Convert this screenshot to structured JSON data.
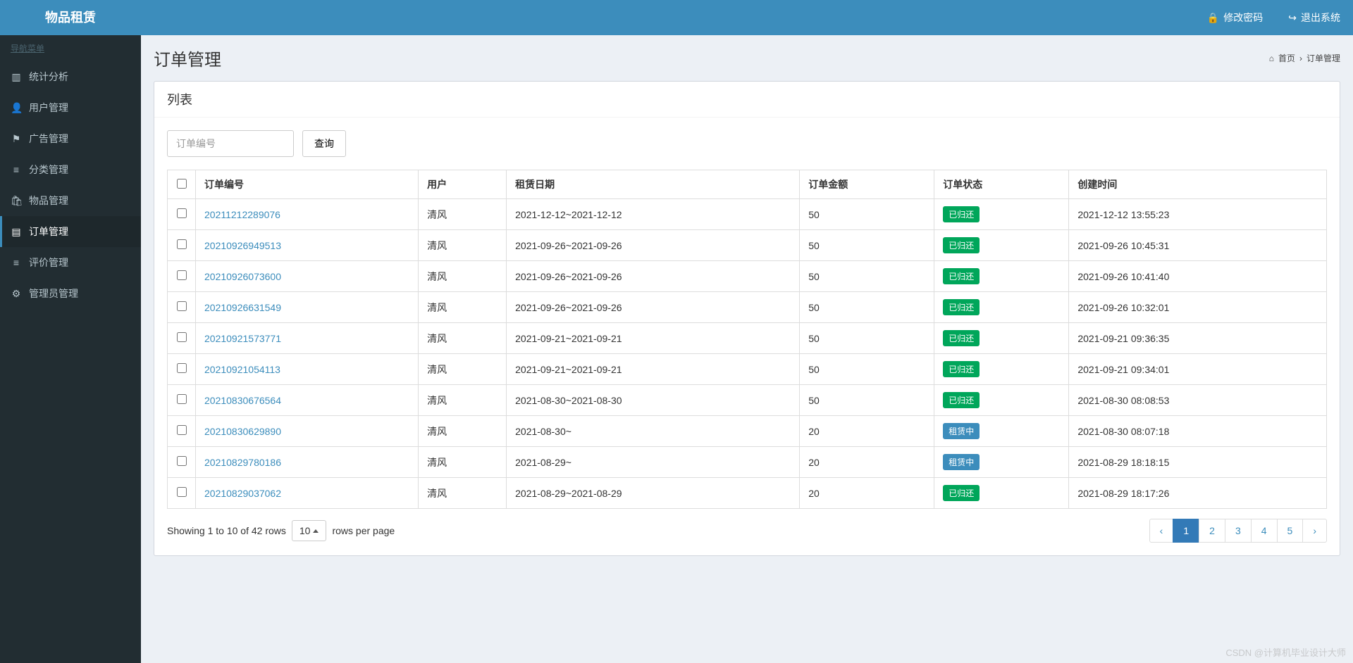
{
  "app": {
    "title": "物品租赁"
  },
  "topbar": {
    "change_pw": "修改密码",
    "logout": "退出系统"
  },
  "sidebar": {
    "header": "导航菜单",
    "items": [
      {
        "icon": "bar-chart-icon",
        "glyph": "▥",
        "label": "统计分析"
      },
      {
        "icon": "user-icon",
        "glyph": "👤",
        "label": "用户管理"
      },
      {
        "icon": "flag-icon",
        "glyph": "⚑",
        "label": "广告管理"
      },
      {
        "icon": "list-icon",
        "glyph": "≡",
        "label": "分类管理"
      },
      {
        "icon": "bag-icon",
        "glyph": "🛍",
        "label": "物品管理"
      },
      {
        "icon": "file-icon",
        "glyph": "▤",
        "label": "订单管理",
        "active": true
      },
      {
        "icon": "comment-icon",
        "glyph": "≡",
        "label": "评价管理"
      },
      {
        "icon": "gear-icon",
        "glyph": "⚙",
        "label": "管理员管理"
      }
    ]
  },
  "page": {
    "title": "订单管理",
    "breadcrumb_home": "首页",
    "breadcrumb_sep": "›",
    "breadcrumb_current": "订单管理"
  },
  "panel": {
    "header": "列表",
    "search_placeholder": "订单编号",
    "search_button": "查询"
  },
  "table": {
    "columns": [
      "订单编号",
      "用户",
      "租赁日期",
      "订单金额",
      "订单状态",
      "创建时间"
    ],
    "rows": [
      {
        "order_no": "20211212289076",
        "user": "清风",
        "date_range": "2021-12-12~2021-12-12",
        "amount": "50",
        "status": "已归还",
        "status_type": "returned",
        "created_at": "2021-12-12 13:55:23"
      },
      {
        "order_no": "20210926949513",
        "user": "清风",
        "date_range": "2021-09-26~2021-09-26",
        "amount": "50",
        "status": "已归还",
        "status_type": "returned",
        "created_at": "2021-09-26 10:45:31"
      },
      {
        "order_no": "20210926073600",
        "user": "清风",
        "date_range": "2021-09-26~2021-09-26",
        "amount": "50",
        "status": "已归还",
        "status_type": "returned",
        "created_at": "2021-09-26 10:41:40"
      },
      {
        "order_no": "20210926631549",
        "user": "清风",
        "date_range": "2021-09-26~2021-09-26",
        "amount": "50",
        "status": "已归还",
        "status_type": "returned",
        "created_at": "2021-09-26 10:32:01"
      },
      {
        "order_no": "20210921573771",
        "user": "清风",
        "date_range": "2021-09-21~2021-09-21",
        "amount": "50",
        "status": "已归还",
        "status_type": "returned",
        "created_at": "2021-09-21 09:36:35"
      },
      {
        "order_no": "20210921054113",
        "user": "清风",
        "date_range": "2021-09-21~2021-09-21",
        "amount": "50",
        "status": "已归还",
        "status_type": "returned",
        "created_at": "2021-09-21 09:34:01"
      },
      {
        "order_no": "20210830676564",
        "user": "清风",
        "date_range": "2021-08-30~2021-08-30",
        "amount": "50",
        "status": "已归还",
        "status_type": "returned",
        "created_at": "2021-08-30 08:08:53"
      },
      {
        "order_no": "20210830629890",
        "user": "清风",
        "date_range": "2021-08-30~",
        "amount": "20",
        "status": "租赁中",
        "status_type": "renting",
        "created_at": "2021-08-30 08:07:18"
      },
      {
        "order_no": "20210829780186",
        "user": "清风",
        "date_range": "2021-08-29~",
        "amount": "20",
        "status": "租赁中",
        "status_type": "renting",
        "created_at": "2021-08-29 18:18:15"
      },
      {
        "order_no": "20210829037062",
        "user": "清风",
        "date_range": "2021-08-29~2021-08-29",
        "amount": "20",
        "status": "已归还",
        "status_type": "returned",
        "created_at": "2021-08-29 18:17:26"
      }
    ]
  },
  "footer": {
    "showing": "Showing 1 to 10 of 42 rows",
    "page_size": "10",
    "rows_per_page": "rows per page",
    "pages": [
      "‹",
      "1",
      "2",
      "3",
      "4",
      "5",
      "›"
    ],
    "current_page": "1"
  },
  "watermark": "CSDN @计算机毕业设计大师"
}
